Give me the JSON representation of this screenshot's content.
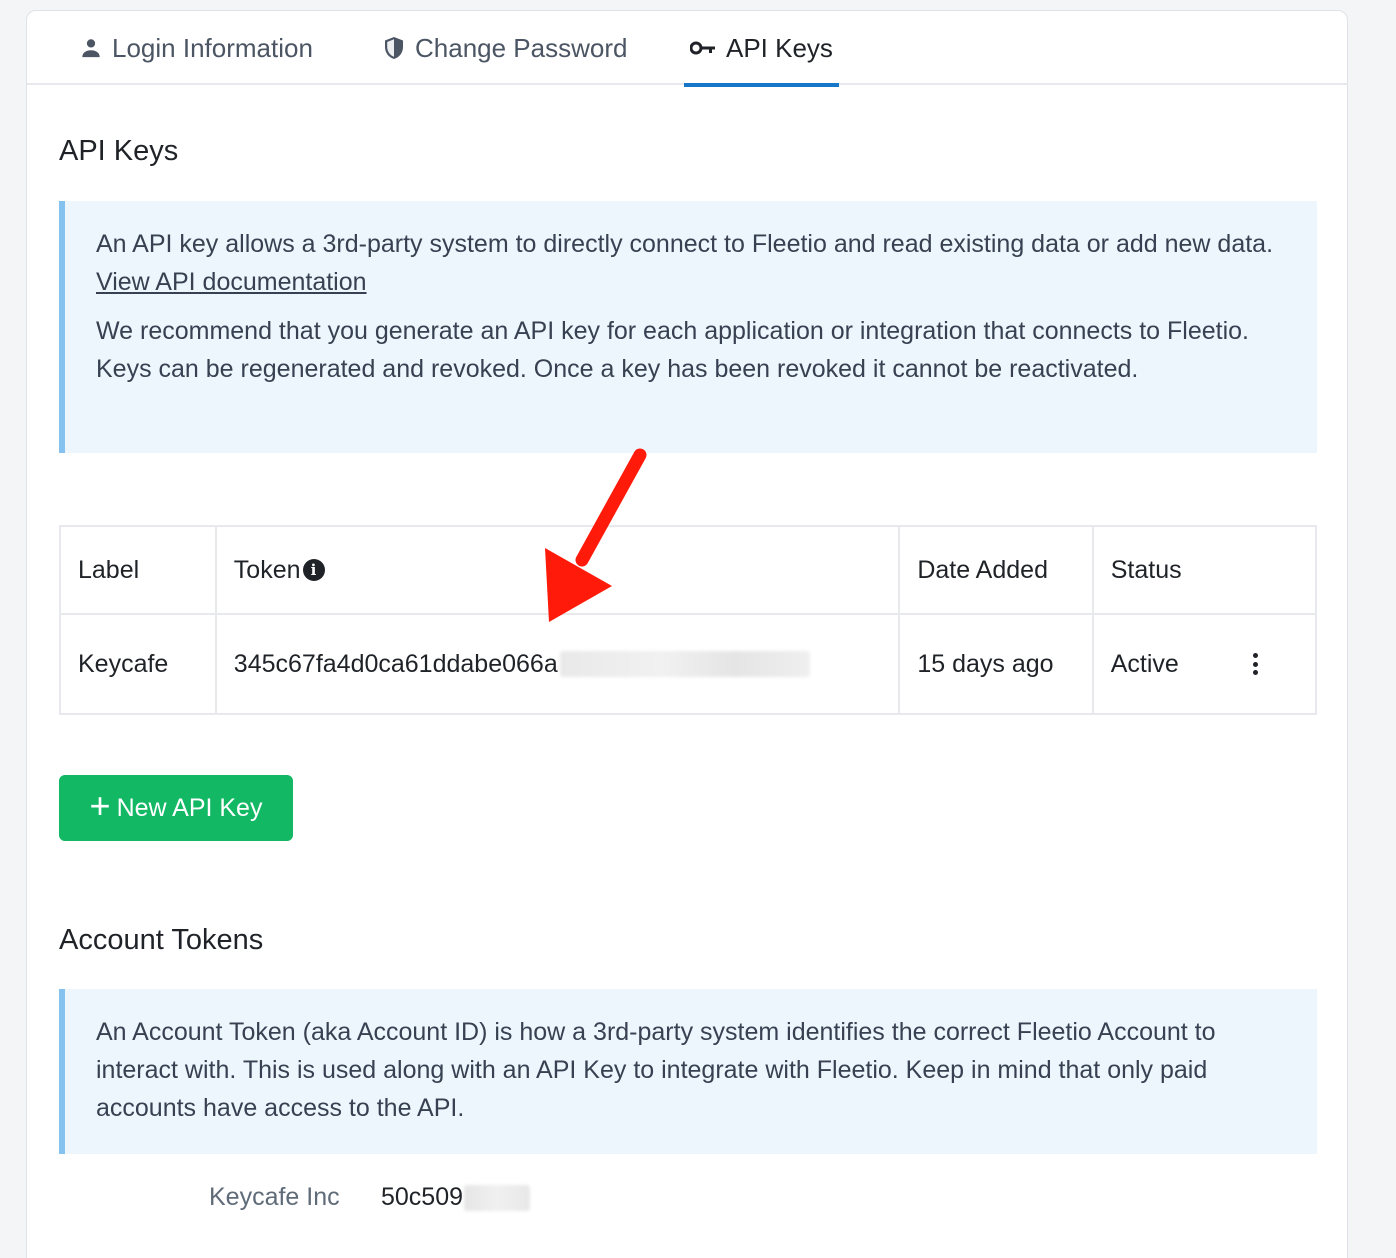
{
  "tabs": [
    {
      "label": "Login Information",
      "icon": "person-icon",
      "active": false
    },
    {
      "label": "Change Password",
      "icon": "shield-icon",
      "active": true
    },
    {
      "label": "API Keys",
      "icon": "key-icon",
      "active": true
    }
  ],
  "api_keys": {
    "title": "API Keys",
    "info_p1": "An API key allows a 3rd-party system to directly connect to Fleetio and read existing data or add new data.",
    "doc_link": "View API documentation",
    "info_p2": "We recommend that you generate an API key for each application or integration that connects to Fleetio. Keys can be regenerated and revoked. Once a key has been revoked it cannot be reactivated.",
    "table": {
      "headers": [
        "Label",
        "Token",
        "Date Added",
        "Status"
      ],
      "rows": [
        {
          "label": "Keycafe",
          "token": "345c67fa4d0ca61ddabe066a",
          "date_added": "15 days ago",
          "status": "Active"
        }
      ]
    },
    "new_button": "New API Key"
  },
  "account_tokens": {
    "title": "Account Tokens",
    "info": "An Account Token (aka Account ID) is how a 3rd-party system identifies the correct Fleetio Account to interact with. This is used along with an API Key to integrate with Fleetio. Keep in mind that only paid accounts have access to the API.",
    "account_name": "Keycafe Inc",
    "account_token": "50c509"
  },
  "colors": {
    "accent": "#1677c9",
    "button_green": "#12b864",
    "callout_bg": "#eef6fd",
    "callout_border": "#86c2ef",
    "annotation_arrow": "#ff1a0a"
  }
}
